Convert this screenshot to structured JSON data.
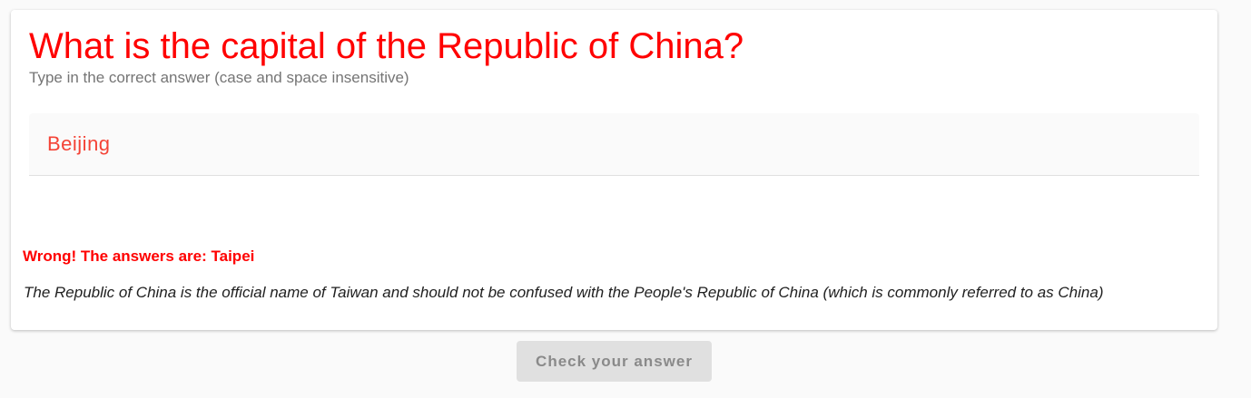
{
  "question": {
    "title": "What is the capital of the Republic of China?",
    "subtitle": "Type in the correct answer (case and space insensitive)"
  },
  "answer_field": {
    "value": "Beijing"
  },
  "feedback": {
    "wrong_message": "Wrong! The answers are: Taipei",
    "explanation": "The Republic of China is the official name of Taiwan and should not be confused with the People's Republic of China (which is commonly referred to as China)"
  },
  "actions": {
    "check_label": "Check your answer"
  },
  "colors": {
    "title": "#ff0000",
    "input_text": "#f44336",
    "wrong": "#ff0000",
    "button_bg": "#e0e0e0",
    "button_text": "#8a8a8a"
  }
}
